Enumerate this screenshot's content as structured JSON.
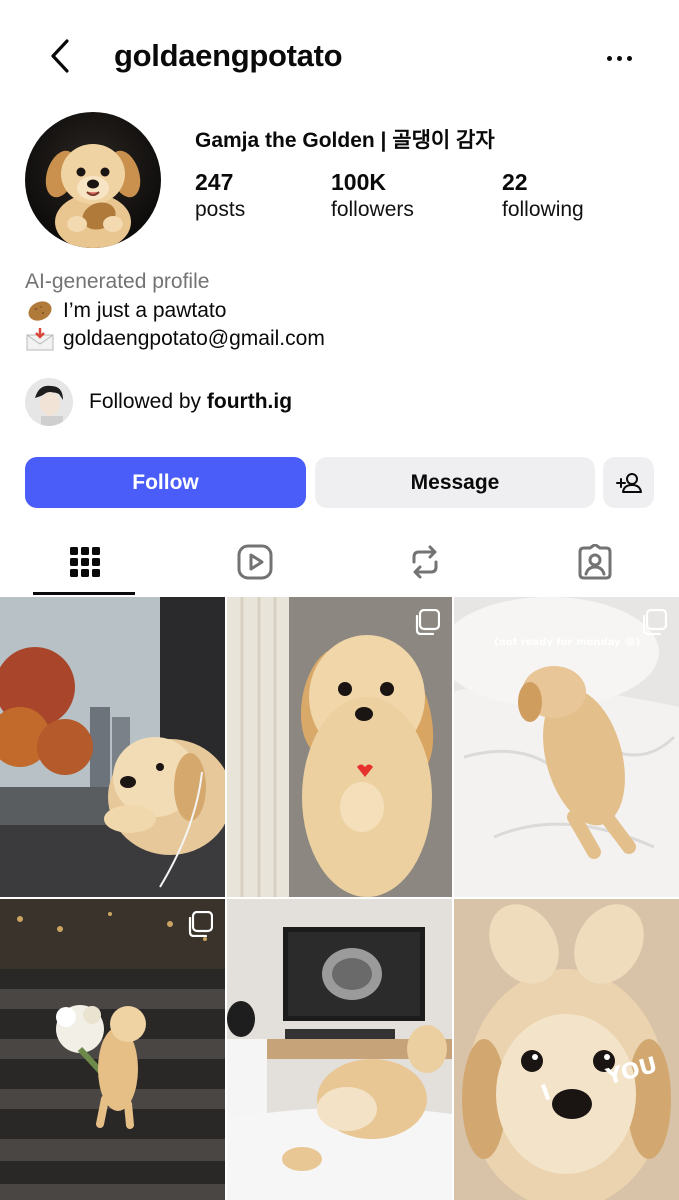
{
  "header": {
    "username": "goldaengpotato"
  },
  "profile": {
    "display_name": "Gamja the Golden | 골댕이 감자",
    "stats": [
      {
        "value": "247",
        "label": "posts"
      },
      {
        "value": "100K",
        "label": "followers"
      },
      {
        "value": "22",
        "label": "following"
      }
    ],
    "bio": {
      "ai_label": "AI-generated profile",
      "line1_emoji": "potato-icon",
      "line1_text": "I’m just a pawtato",
      "line2_emoji": "envelope-icon",
      "line2_text": "goldaengpotato@gmail.com"
    },
    "followed_by_prefix": "Followed by ",
    "followed_by_user": "fourth.ig"
  },
  "actions": {
    "follow_label": "Follow",
    "message_label": "Message"
  },
  "tabs": [
    {
      "name": "grid-icon",
      "active": true
    },
    {
      "name": "reels-icon",
      "active": false
    },
    {
      "name": "reposts-icon",
      "active": false
    },
    {
      "name": "tagged-icon",
      "active": false
    }
  ],
  "posts": [
    {
      "scene": "puppy by rainy window",
      "multi": false
    },
    {
      "scene": "puppy behind curtain with heart",
      "multi": true
    },
    {
      "scene": "puppy lying on bed",
      "multi": true,
      "overlay_text": "(not ready for monday 😂)"
    },
    {
      "scene": "puppy with flowers on crosswalk",
      "multi": true
    },
    {
      "scene": "puppy ultrasound on bed",
      "multi": false
    },
    {
      "scene": "puppy making heart",
      "multi": false,
      "overlay_text_left": "I",
      "overlay_text_right": "YOU"
    }
  ],
  "colors": {
    "follow_button": "#4a5df9",
    "secondary_button": "#efeff1",
    "muted_text": "#737373"
  }
}
